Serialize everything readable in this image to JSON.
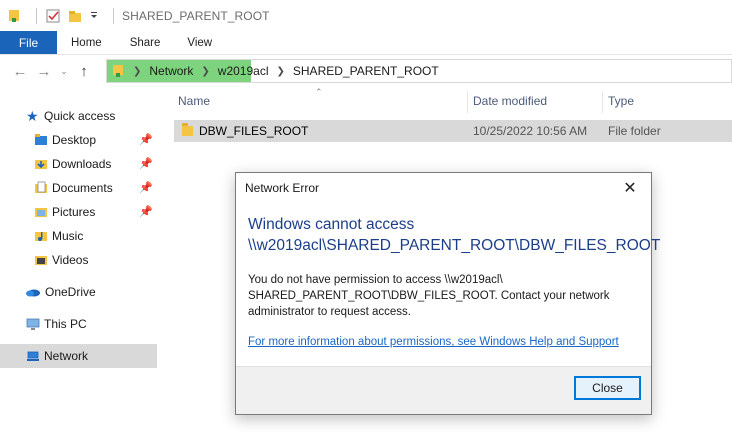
{
  "window": {
    "title": "SHARED_PARENT_ROOT"
  },
  "ribbon": {
    "tabs": [
      "File",
      "Home",
      "Share",
      "View"
    ]
  },
  "address": {
    "crumbs": [
      "Network",
      "w2019acl",
      "SHARED_PARENT_ROOT"
    ]
  },
  "nav": {
    "quick_access": "Quick access",
    "items": [
      {
        "label": "Desktop",
        "icon": "desktop-folder-icon",
        "pinned": true
      },
      {
        "label": "Downloads",
        "icon": "downloads-folder-icon",
        "pinned": true
      },
      {
        "label": "Documents",
        "icon": "documents-folder-icon",
        "pinned": true
      },
      {
        "label": "Pictures",
        "icon": "pictures-folder-icon",
        "pinned": true
      },
      {
        "label": "Music",
        "icon": "music-folder-icon",
        "pinned": false
      },
      {
        "label": "Videos",
        "icon": "videos-folder-icon",
        "pinned": false
      }
    ],
    "onedrive": "OneDrive",
    "this_pc": "This PC",
    "network": "Network"
  },
  "columns": {
    "name": "Name",
    "date": "Date modified",
    "type": "Type"
  },
  "files": [
    {
      "name": "DBW_FILES_ROOT",
      "date": "10/25/2022 10:56 AM",
      "type": "File folder"
    }
  ],
  "dialog": {
    "title": "Network Error",
    "heading_line1": "Windows cannot access",
    "heading_line2": "\\\\w2019acl\\SHARED_PARENT_ROOT\\DBW_FILES_ROOT",
    "message_line1": "You do not have permission to access \\\\w2019acl\\",
    "message_line2": "SHARED_PARENT_ROOT\\DBW_FILES_ROOT. Contact your network",
    "message_line3": "administrator to request access.",
    "link": "For more information about permissions, see Windows Help and Support",
    "close_button": "Close"
  },
  "colors": {
    "accent": "#1a64b9",
    "highlight": "#7ed37e",
    "selected_row": "#d9d9d9",
    "heading": "#1c3e8a",
    "link": "#1a66c5"
  }
}
